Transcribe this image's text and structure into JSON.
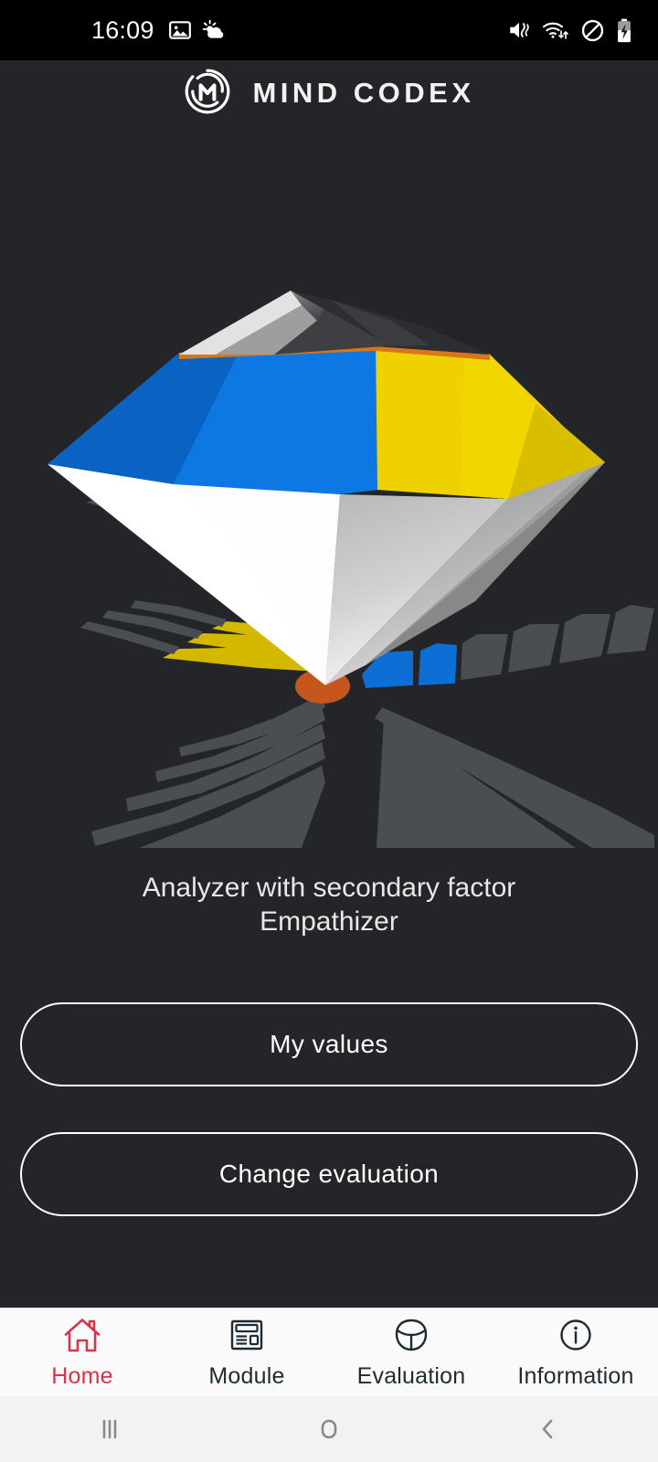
{
  "statusbar": {
    "time": "16:09",
    "left_icons": [
      "image-icon",
      "weather-icon"
    ],
    "right_icons": [
      "vibrate-mute-icon",
      "wifi-data-icon",
      "do-not-disturb-icon",
      "battery-charging-icon"
    ]
  },
  "header": {
    "logo_icon": "mind-codex-logo-icon",
    "brand": "MIND CODEX"
  },
  "visual": {
    "name": "personality-gem-visualization",
    "colors": {
      "background": "#232529",
      "blue": "#0d77e3",
      "blue_dark": "#0a63c2",
      "yellow": "#efd000",
      "yellow_dark": "#d9be00",
      "white": "#ffffff",
      "gray_light": "#d9d9d9",
      "gray_mid": "#9a9a9a",
      "gray_dark": "#3f4247",
      "platform_gray": "#4a4d52",
      "orange": "#c4561e",
      "orange_rim": "#d8761a",
      "peak_dark": "#2e3034"
    },
    "platform_yellow_rings": 3,
    "platform_blue_rings": 2,
    "platform_gray_rings": 5
  },
  "result": {
    "text": "Analyzer with secondary factor Empathizer",
    "line1": "Analyzer with secondary factor",
    "line2": "Empathizer"
  },
  "buttons": {
    "my_values": "My values",
    "change_evaluation": "Change evaluation"
  },
  "bottomnav": {
    "active_color": "#d8334a",
    "inactive_color": "#1d2b33",
    "items": [
      {
        "label": "Home",
        "icon": "home-icon",
        "active": true
      },
      {
        "label": "Module",
        "icon": "module-layout-icon",
        "active": false
      },
      {
        "label": "Evaluation",
        "icon": "segmented-sphere-icon",
        "active": false
      },
      {
        "label": "Information",
        "icon": "info-circle-icon",
        "active": false
      }
    ]
  },
  "sysnav": {
    "items": [
      {
        "name": "recents-button",
        "glyph": "|||"
      },
      {
        "name": "home-button",
        "glyph": "O"
      },
      {
        "name": "back-button",
        "glyph": "‹"
      }
    ]
  }
}
